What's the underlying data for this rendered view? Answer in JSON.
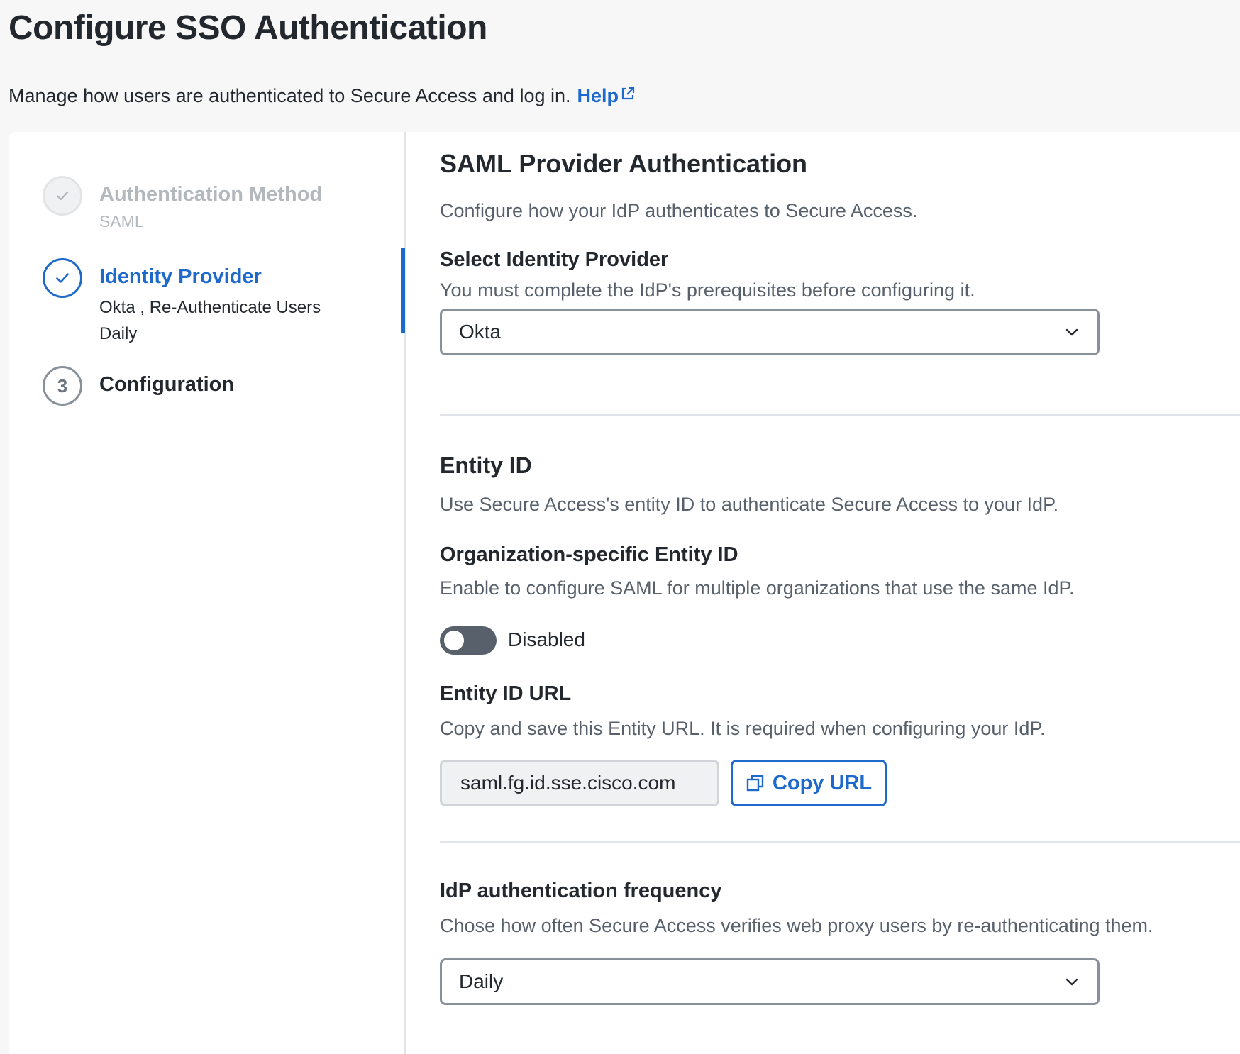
{
  "header": {
    "title": "Configure SSO Authentication",
    "subtitle": "Manage how users are authenticated to Secure Access and log in.",
    "help_label": "Help",
    "help_icon": "external-link-icon"
  },
  "stepper": {
    "steps": [
      {
        "number": "",
        "title": "Authentication Method",
        "subtitle": "SAML",
        "state": "completed",
        "icon": "check-icon"
      },
      {
        "number": "",
        "title": "Identity Provider",
        "subtitle": "Okta , Re-Authenticate Users Daily",
        "state": "active",
        "icon": "check-icon"
      },
      {
        "number": "3",
        "title": "Configuration",
        "subtitle": "",
        "state": "upcoming"
      }
    ]
  },
  "saml": {
    "title": "SAML Provider Authentication",
    "description": "Configure how your IdP authenticates to Secure Access.",
    "select_idp": {
      "label": "Select Identity Provider",
      "help": "You must complete the IdP's prerequisites before configuring it.",
      "value": "Okta"
    }
  },
  "entity": {
    "title": "Entity ID",
    "description": "Use Secure Access's entity ID to authenticate Secure Access to your IdP.",
    "org_specific": {
      "label": "Organization-specific Entity ID",
      "help": "Enable to configure SAML for multiple organizations that use the same IdP.",
      "toggle_state": "Disabled"
    },
    "url": {
      "label": "Entity ID URL",
      "help": "Copy and save this Entity URL. It is required when configuring your IdP.",
      "value": "saml.fg.id.sse.cisco.com",
      "copy_label": "Copy URL",
      "copy_icon": "copy-icon"
    }
  },
  "frequency": {
    "label": "IdP authentication frequency",
    "help": "Chose how often Secure Access verifies web proxy users by re-authenticating them.",
    "value": "Daily"
  },
  "colors": {
    "accent": "#1d69cc",
    "text": "#23282e",
    "muted": "#58616b",
    "disabled": "#b3b8bd",
    "background": "#f7f7f8"
  }
}
